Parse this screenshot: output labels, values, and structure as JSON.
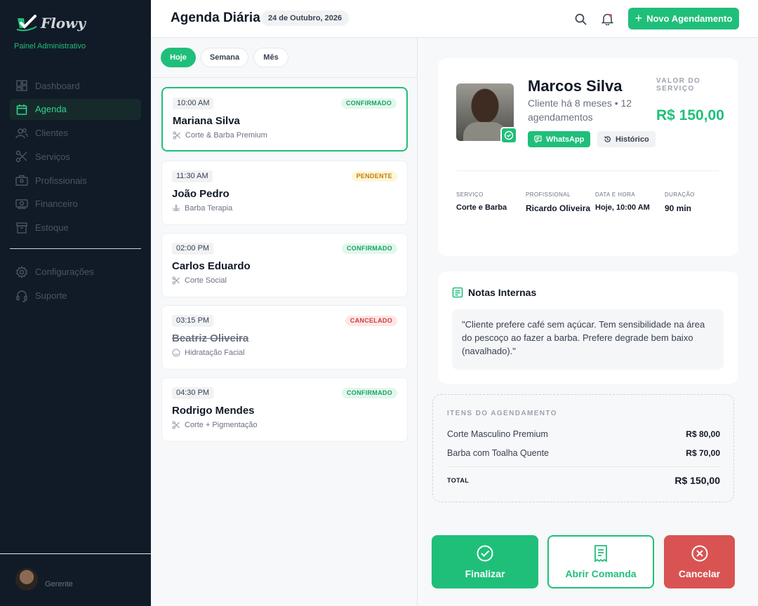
{
  "app": {
    "logo_text": "Flowy",
    "panel_label": "Painel Administrativo"
  },
  "sidebar": {
    "items": [
      {
        "label": "Dashboard",
        "icon": "dashboard-icon",
        "active": false
      },
      {
        "label": "Agenda",
        "icon": "calendar-icon",
        "active": true
      },
      {
        "label": "Clientes",
        "icon": "users-icon",
        "active": false
      },
      {
        "label": "Serviços",
        "icon": "scissors-icon",
        "active": false
      },
      {
        "label": "Profissionais",
        "icon": "briefcase-icon",
        "active": false
      },
      {
        "label": "Financeiro",
        "icon": "money-icon",
        "active": false
      },
      {
        "label": "Estoque",
        "icon": "box-icon",
        "active": false
      }
    ],
    "secondary": [
      {
        "label": "Configurações",
        "icon": "gear-icon"
      },
      {
        "label": "Suporte",
        "icon": "support-icon"
      }
    ],
    "user_role": "Gerente"
  },
  "header": {
    "title": "Agenda Diária",
    "date": "24 de Outubro, 2026",
    "new_button": "Novo Agendamento"
  },
  "tabs": [
    {
      "label": "Hoje",
      "active": true
    },
    {
      "label": "Semana",
      "active": false
    },
    {
      "label": "Mês",
      "active": false
    }
  ],
  "appointments": [
    {
      "time": "10:00 AM",
      "status": "CONFIRMADO",
      "status_type": "ok",
      "name": "Mariana Silva",
      "service": "Corte & Barba Premium",
      "icon": "scissors-icon"
    },
    {
      "time": "11:30 AM",
      "status": "PENDENTE",
      "status_type": "pend",
      "name": "João Pedro",
      "service": "Barba Terapia",
      "icon": "spa-icon"
    },
    {
      "time": "02:00 PM",
      "status": "CONFIRMADO",
      "status_type": "ok",
      "name": "Carlos Eduardo",
      "service": "Corte Social",
      "icon": "scissors-icon"
    },
    {
      "time": "03:15 PM",
      "status": "CANCELADO",
      "status_type": "canc",
      "name": "Beatriz Oliveira",
      "service": "Hidratação Facial",
      "icon": "face-icon"
    },
    {
      "time": "04:30 PM",
      "status": "CONFIRMADO",
      "status_type": "ok",
      "name": "Rodrigo Mendes",
      "service": "Corte + Pigmentação",
      "icon": "scissors-icon"
    }
  ],
  "detail": {
    "client_name": "Marcos Silva",
    "client_meta": "Cliente há 8 meses • 12 agendamentos",
    "whatsapp_label": "WhatsApp",
    "history_label": "Histórico",
    "value_label": "VALOR DO SERVIÇO",
    "value": "R$ 150,00",
    "info": [
      {
        "label": "SERVIÇO",
        "value": "Corte e Barba"
      },
      {
        "label": "PROFISSIONAL",
        "value": "Ricardo Oliveira"
      },
      {
        "label": "DATA E HORA",
        "value": "Hoje, 10:00 AM"
      },
      {
        "label": "DURAÇÃO",
        "value": "90 min"
      }
    ]
  },
  "notes": {
    "title": "Notas Internas",
    "text": "\"Cliente prefere café sem açúcar. Tem sensibilidade na área do pescoço ao fazer a barba. Prefere degrade bem baixo (navalhado).\""
  },
  "items": {
    "heading": "ITENS DO AGENDAMENTO",
    "rows": [
      {
        "label": "Corte Masculino Premium",
        "price": "R$ 80,00"
      },
      {
        "label": "Barba com Toalha Quente",
        "price": "R$ 70,00"
      }
    ],
    "total_label": "TOTAL",
    "total_value": "R$ 150,00"
  },
  "actions": {
    "finalize": "Finalizar",
    "open_order": "Abrir Comanda",
    "cancel": "Cancelar"
  },
  "colors": {
    "accent": "#1fbf7a",
    "sidebar": "#111b27",
    "danger": "#d95353"
  }
}
